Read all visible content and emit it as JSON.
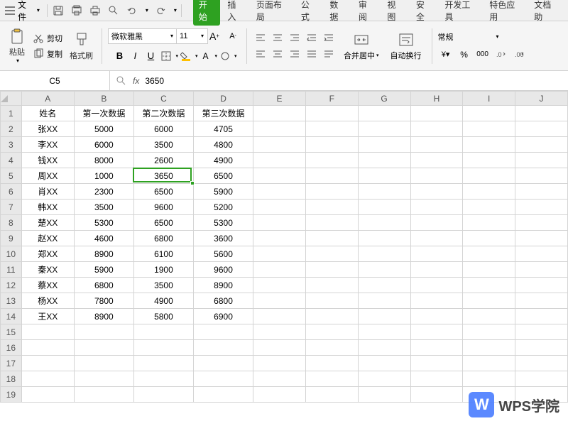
{
  "menubar": {
    "file_label": "文件"
  },
  "tabs": {
    "start": "开始",
    "insert": "插入",
    "layout": "页面布局",
    "formula": "公式",
    "data": "数据",
    "review": "审阅",
    "view": "视图",
    "security": "安全",
    "devtools": "开发工具",
    "special": "特色应用",
    "dochelp": "文档助"
  },
  "ribbon": {
    "paste": "粘贴",
    "cut": "剪切",
    "copy": "复制",
    "format_painter": "格式刷",
    "font_name": "微软雅黑",
    "font_size": "11",
    "merge_center": "合并居中",
    "auto_wrap": "自动换行",
    "number_format": "常规"
  },
  "formula_bar": {
    "cell_ref": "C5",
    "value": "3650"
  },
  "columns": [
    "A",
    "B",
    "C",
    "D",
    "E",
    "F",
    "G",
    "H",
    "I",
    "J"
  ],
  "headers": {
    "name": "姓名",
    "d1": "第一次数据",
    "d2": "第二次数据",
    "d3": "第三次数据"
  },
  "rows": [
    {
      "name": "张XX",
      "d1": "5000",
      "d2": "6000",
      "d3": "4705"
    },
    {
      "name": "李XX",
      "d1": "6000",
      "d2": "3500",
      "d3": "4800"
    },
    {
      "name": "钱XX",
      "d1": "8000",
      "d2": "2600",
      "d3": "4900"
    },
    {
      "name": "周XX",
      "d1": "1000",
      "d2": "3650",
      "d3": "6500"
    },
    {
      "name": "肖XX",
      "d1": "2300",
      "d2": "6500",
      "d3": "5900"
    },
    {
      "name": "韩XX",
      "d1": "3500",
      "d2": "9600",
      "d3": "5200"
    },
    {
      "name": "楚XX",
      "d1": "5300",
      "d2": "6500",
      "d3": "5300"
    },
    {
      "name": "赵XX",
      "d1": "4600",
      "d2": "6800",
      "d3": "3600"
    },
    {
      "name": "郑XX",
      "d1": "8900",
      "d2": "6100",
      "d3": "5600"
    },
    {
      "name": "秦XX",
      "d1": "5900",
      "d2": "1900",
      "d3": "9600"
    },
    {
      "name": "蔡XX",
      "d1": "6800",
      "d2": "3500",
      "d3": "8900"
    },
    {
      "name": "杨XX",
      "d1": "7800",
      "d2": "4900",
      "d3": "6800"
    },
    {
      "name": "王XX",
      "d1": "8900",
      "d2": "5800",
      "d3": "6900"
    }
  ],
  "watermark": {
    "logo_text": "W",
    "text": "WPS学院"
  },
  "active_cell": {
    "row": 5,
    "col": "C"
  }
}
